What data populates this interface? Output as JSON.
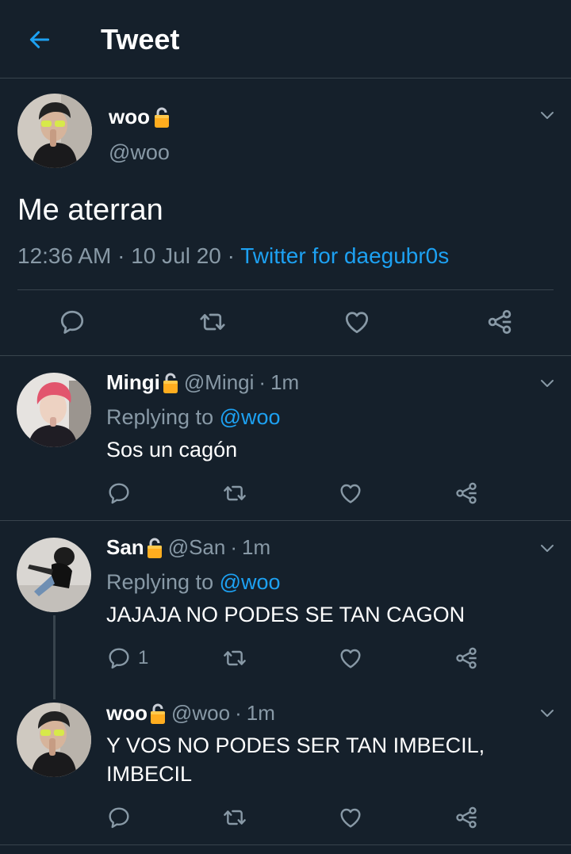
{
  "header": {
    "title": "Tweet",
    "back_icon": "arrow-left-icon"
  },
  "colors": {
    "background": "#15202b",
    "accent": "#1da1f2",
    "muted": "#8899a6",
    "divider": "#38444d",
    "lock": "#ffad1f"
  },
  "main_tweet": {
    "name": "woo",
    "handle": "@woo",
    "text": "Me aterran",
    "time": "12:36 AM",
    "date": "10 Jul 20",
    "separator": "·",
    "source": "Twitter for daegubr0s"
  },
  "replies": [
    {
      "name": "Mingi",
      "handle": "@Mingi",
      "separator": "·",
      "time": "1m",
      "replying_label": "Replying to",
      "replying_to": "@woo",
      "text": "Sos un cagón",
      "reply_count": ""
    },
    {
      "name": "San",
      "handle": "@San",
      "separator": "·",
      "time": "1m",
      "replying_label": "Replying to",
      "replying_to": "@woo",
      "text": "JAJAJA NO PODES SE TAN CAGON",
      "reply_count": "1"
    },
    {
      "name": "woo",
      "handle": "@woo",
      "separator": "·",
      "time": "1m",
      "text": "Y VOS NO PODES SER TAN IMBECIL,\nIMBECIL",
      "reply_count": ""
    }
  ],
  "icons": [
    "reply-icon",
    "retweet-icon",
    "like-icon",
    "share-icon",
    "chevron-down-icon",
    "lock-icon"
  ]
}
